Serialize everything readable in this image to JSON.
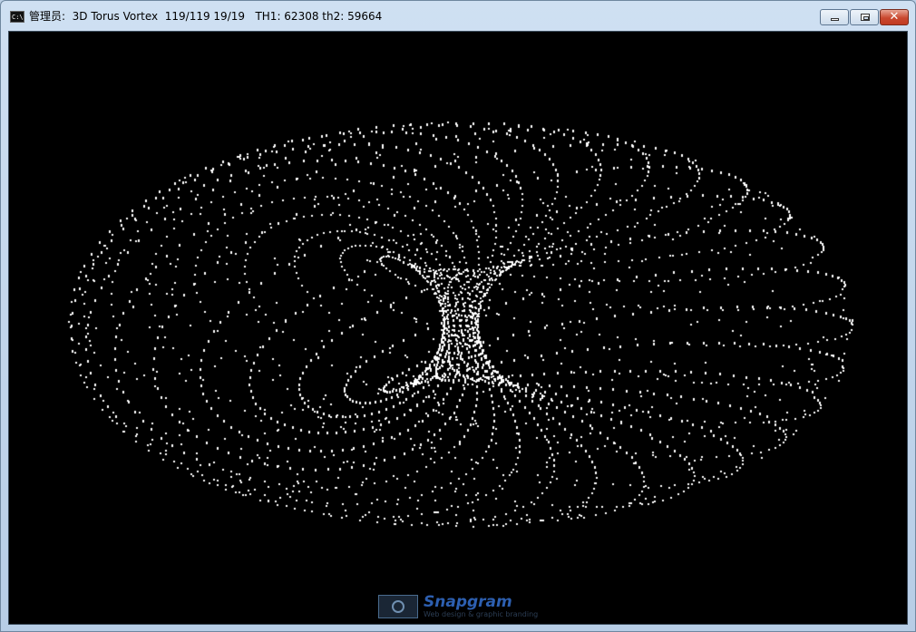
{
  "window": {
    "title": "管理员:  3D Torus Vortex  119/119 19/19   TH1: 62308 th2: 59664",
    "icon": "console-icon",
    "icon_text": "C:\\",
    "controls": {
      "minimize": "minimize-icon",
      "maximize": "maximize-icon",
      "close_label": "✕"
    }
  },
  "canvas": {
    "background": "#000000",
    "dot_color": "#ffffff",
    "description_icon": "torus-point-cloud"
  },
  "watermark": {
    "brand": "Snapgram",
    "tagline": "Web design & graphic branding",
    "icon": "camera-icon"
  }
}
